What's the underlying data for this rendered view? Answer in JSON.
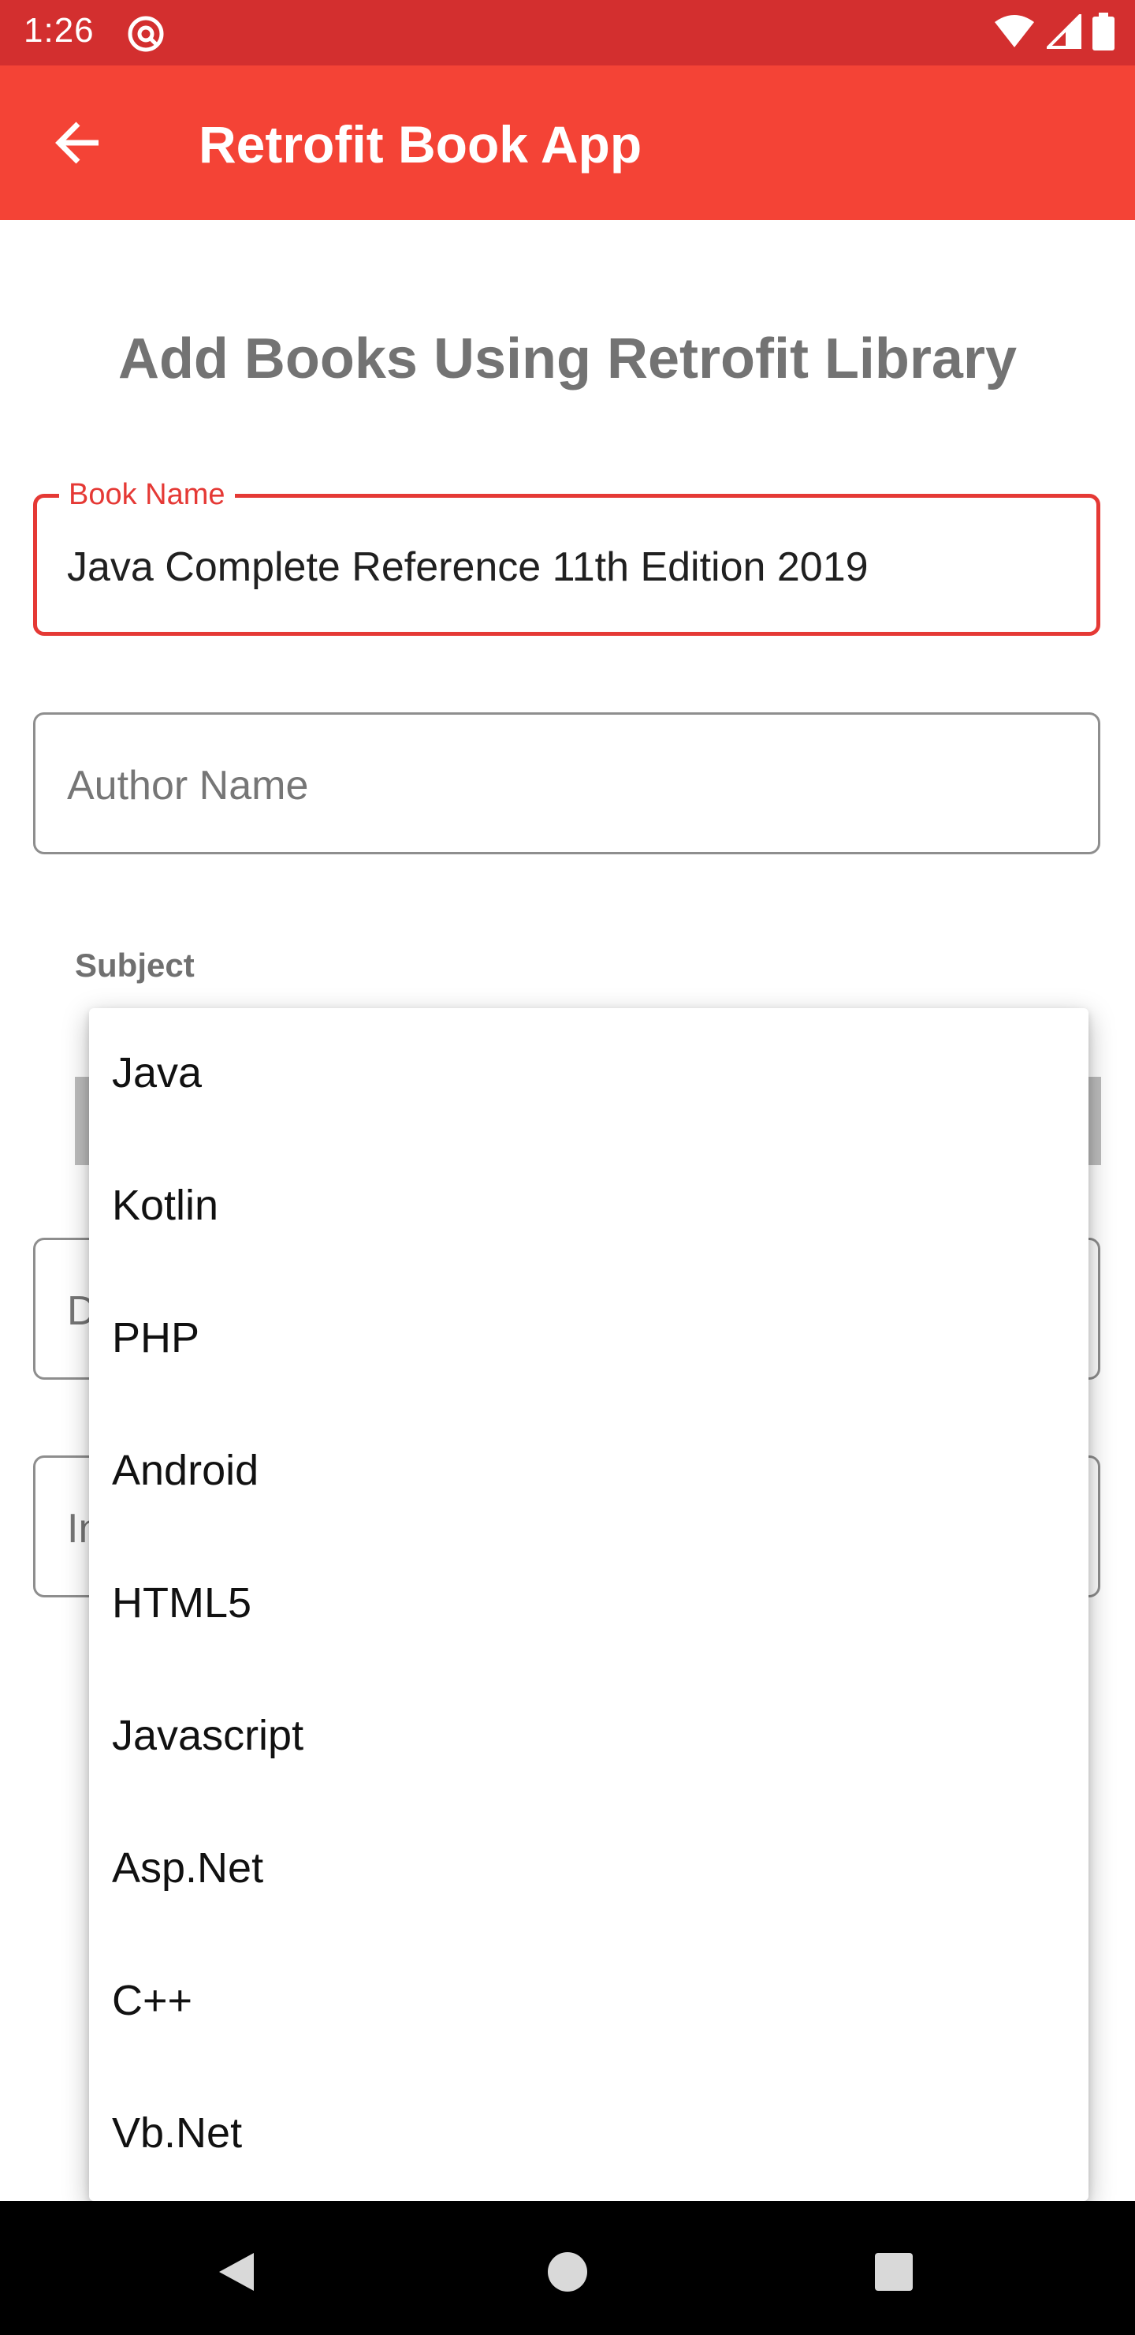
{
  "status_bar": {
    "time": "1:26",
    "icons": [
      "at-sign-notification-icon",
      "wifi-icon",
      "cellular-signal-icon",
      "battery-icon"
    ]
  },
  "app_bar": {
    "title": "Retrofit Book App",
    "back_icon": "arrow-back-icon",
    "background_color": "#f44336"
  },
  "page": {
    "heading": "Add Books Using Retrofit Library"
  },
  "form": {
    "book_name": {
      "label": "Book Name",
      "value": "Java  Complete Reference 11th Edition 2019"
    },
    "author_name": {
      "placeholder": "Author Name"
    },
    "subject_label": "Subject",
    "field3_partial": "D",
    "field4_partial": "In"
  },
  "dropdown": {
    "options": [
      "Java",
      "Kotlin",
      "PHP",
      "Android",
      "HTML5",
      "Javascript",
      "Asp.Net",
      "C++",
      "Vb.Net"
    ]
  },
  "nav_bar": {
    "icons": [
      "nav-back-icon",
      "nav-home-icon",
      "nav-recents-icon"
    ]
  },
  "colors": {
    "status_bar": "#d32f2f",
    "accent": "#e53935"
  }
}
